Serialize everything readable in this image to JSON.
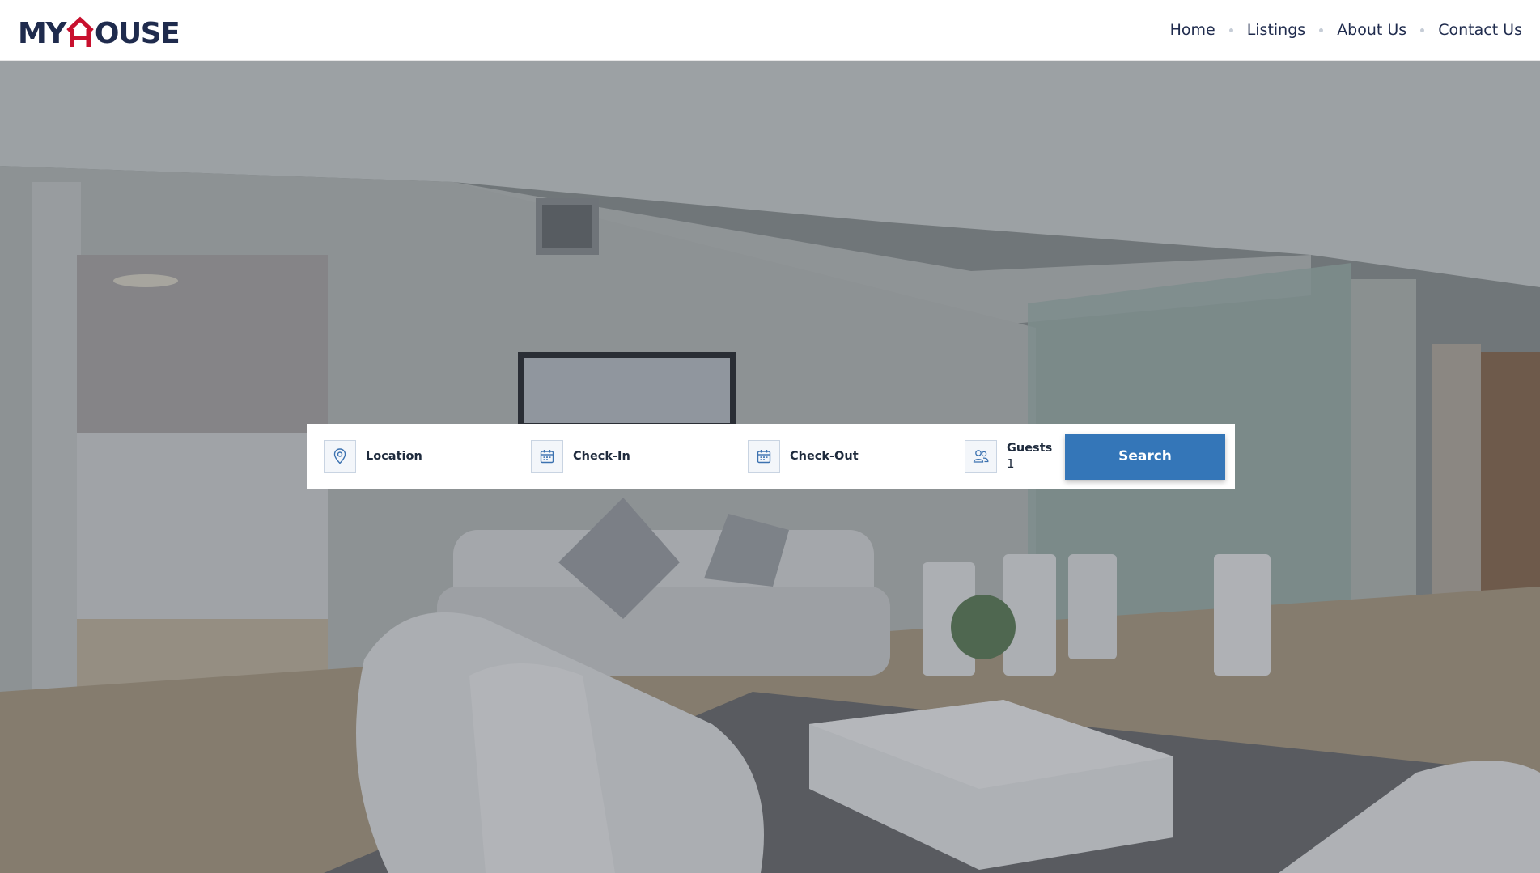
{
  "brand": {
    "logo_left": "MY",
    "logo_right": "OUSE",
    "logo_text": "MYHOUSE",
    "colors": {
      "navy": "#1f2b4d",
      "red": "#c8102e"
    }
  },
  "nav": {
    "items": [
      {
        "label": "Home"
      },
      {
        "label": "Listings"
      },
      {
        "label": "About Us"
      },
      {
        "label": "Contact Us"
      }
    ]
  },
  "hero": {
    "image": "living-room-photo"
  },
  "search": {
    "location_label": "Location",
    "location_icon": "map-pin-icon",
    "checkin_label": "Check-In",
    "checkin_icon": "calendar-icon",
    "checkout_label": "Check-Out",
    "checkout_icon": "calendar-icon",
    "guests_label": "Guests",
    "guests_value": "1",
    "guests_icon": "users-icon",
    "button_label": "Search",
    "button_color": "#3476b8"
  }
}
